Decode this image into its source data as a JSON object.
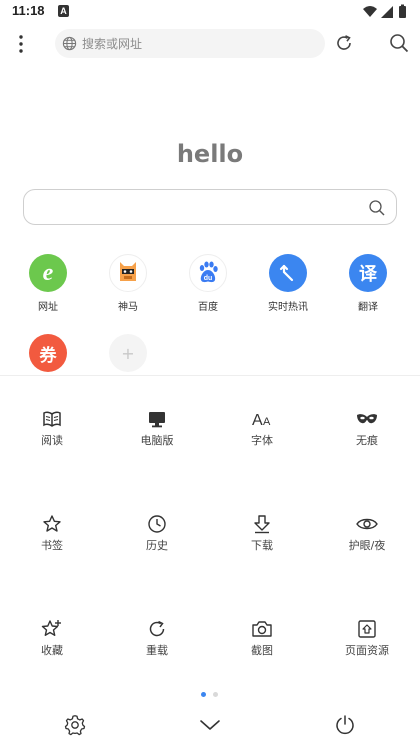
{
  "status_bar": {
    "time": "11:18",
    "notif_letter": "A"
  },
  "toolbar": {
    "address_placeholder": "搜索或网址"
  },
  "home": {
    "title": "hello"
  },
  "shortcuts": [
    {
      "label": "网址",
      "icon": "e-icon",
      "color": "#6cc84d",
      "glyph": "e"
    },
    {
      "label": "神马",
      "icon": "shenma-icon",
      "color": "#f6a14a",
      "glyph": ""
    },
    {
      "label": "百度",
      "icon": "baidu-icon",
      "color": "#3a7bf2",
      "glyph": "du"
    },
    {
      "label": "实时热讯",
      "icon": "arrow-icon",
      "color": "#3b86f0",
      "glyph": ""
    },
    {
      "label": "翻译",
      "icon": "translate-icon",
      "color": "#3b86f0",
      "glyph": "译"
    },
    {
      "label": "",
      "icon": "coupon-icon",
      "color": "#f25a3f",
      "glyph": "券"
    },
    {
      "label": "",
      "icon": "add-icon",
      "color": "#f3f3f3",
      "glyph": "+"
    }
  ],
  "menu": [
    {
      "label": "阅读",
      "icon": "book-icon"
    },
    {
      "label": "电脑版",
      "icon": "monitor-icon"
    },
    {
      "label": "字体",
      "icon": "font-icon"
    },
    {
      "label": "无痕",
      "icon": "mask-icon"
    },
    {
      "label": "书签",
      "icon": "star-icon"
    },
    {
      "label": "历史",
      "icon": "clock-icon"
    },
    {
      "label": "下载",
      "icon": "download-icon"
    },
    {
      "label": "护眼/夜",
      "icon": "eye-icon"
    },
    {
      "label": "收藏",
      "icon": "star-plus-icon"
    },
    {
      "label": "重载",
      "icon": "reload-icon"
    },
    {
      "label": "截图",
      "icon": "camera-icon"
    },
    {
      "label": "页面资源",
      "icon": "resource-icon"
    }
  ],
  "colors": {
    "accent": "#3b86f0",
    "page_dot_active": "#3b86f0",
    "page_dot_inactive": "#d9d9d9"
  }
}
